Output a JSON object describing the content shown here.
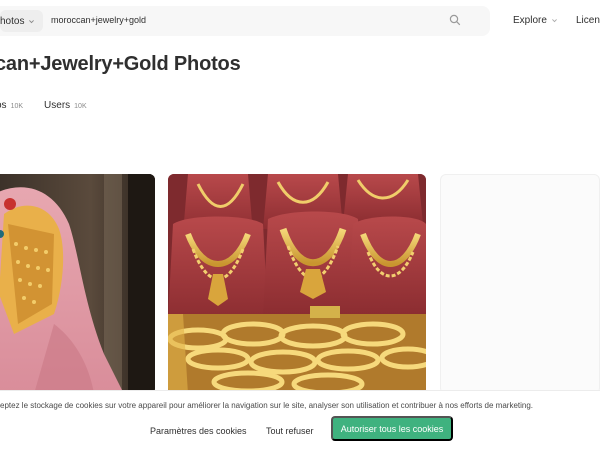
{
  "search": {
    "type_label": "hotos",
    "query": "moroccan+jewelry+gold"
  },
  "nav": {
    "explore_label": "Explore",
    "license_label": "Licens"
  },
  "page": {
    "title": "can+Jewelry+Gold Photos"
  },
  "tabs": [
    {
      "label": "os",
      "count": "10K"
    },
    {
      "label": "Users",
      "count": "10K"
    }
  ],
  "photos": [
    {
      "name": "woman-in-pink-veil-with-gold-headpiece"
    },
    {
      "name": "gold-necklaces-on-red-display-stands"
    }
  ],
  "cookie": {
    "text": "eptez le stockage de cookies sur votre appareil pour améliorer la navigation sur le site, analyser son utilisation et contribuer à nos efforts de marketing.",
    "settings_label": "Paramètres des cookies",
    "refuse_label": "Tout refuser",
    "accept_label": "Autoriser tous les cookies"
  },
  "colors": {
    "accent": "#3fb27f",
    "text": "#2f2f2f",
    "search_bg": "#f7f7f7"
  }
}
